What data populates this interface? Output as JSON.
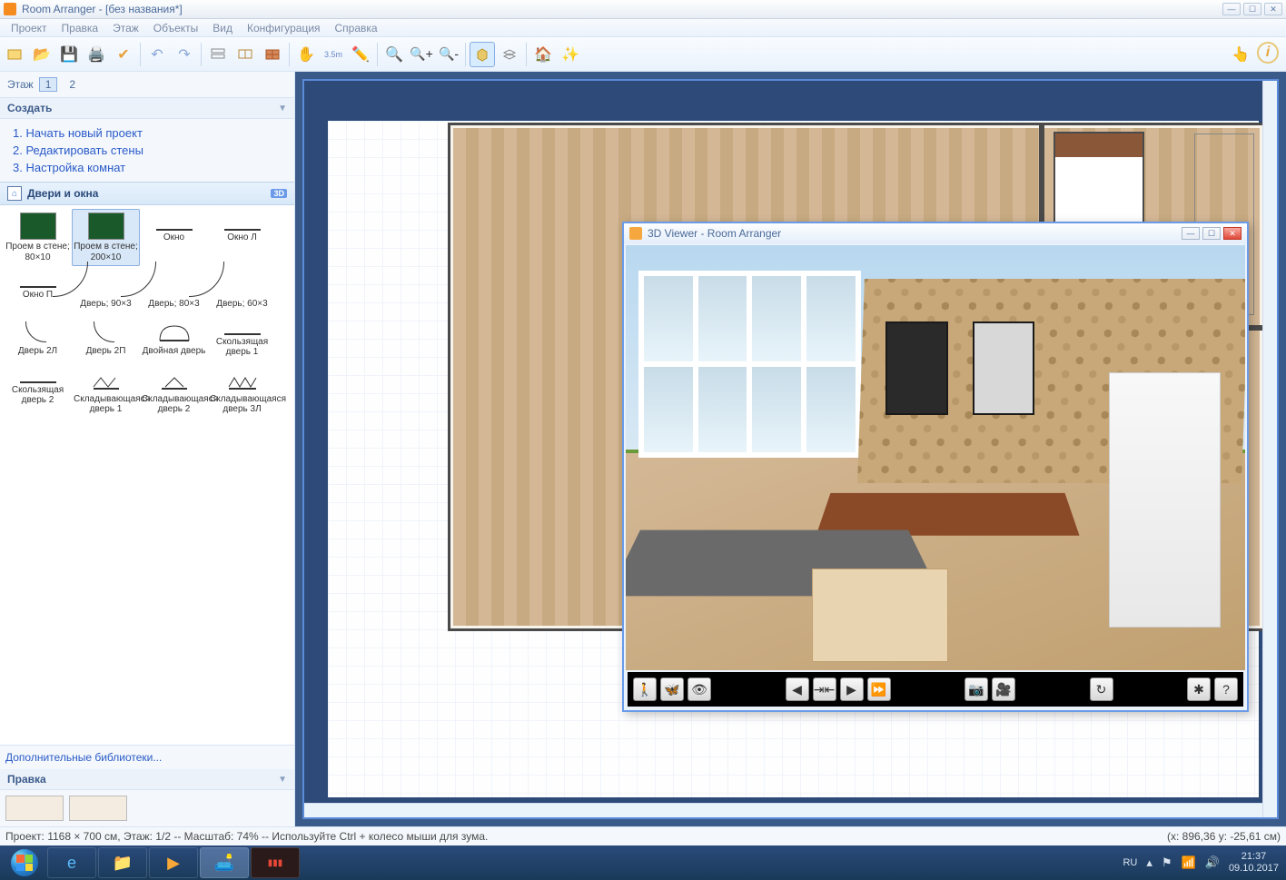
{
  "titlebar": {
    "title": "Room Arranger - [без названия*]"
  },
  "menu": {
    "items": [
      "Проект",
      "Правка",
      "Этаж",
      "Объекты",
      "Вид",
      "Конфигурация",
      "Справка"
    ]
  },
  "toolbar": {
    "measure_label": "3.5m"
  },
  "sidebar": {
    "floor_label": "Этаж",
    "floors": [
      "1",
      "2"
    ],
    "create_header": "Создать",
    "create_steps": [
      "1. Начать новый проект",
      "2. Редактировать стены",
      "3. Настройка комнат"
    ],
    "category": {
      "name": "Двери и окна",
      "badge": "3D"
    },
    "library_items": [
      {
        "label": "Проем в стене; 80×10"
      },
      {
        "label": "Проем в стене; 200×10"
      },
      {
        "label": "Окно"
      },
      {
        "label": "Окно Л"
      },
      {
        "label": "Окно П"
      },
      {
        "label": "Дверь; 90×3"
      },
      {
        "label": "Дверь; 80×3"
      },
      {
        "label": "Дверь; 60×3"
      },
      {
        "label": "Дверь 2Л"
      },
      {
        "label": "Дверь 2П"
      },
      {
        "label": "Двойная дверь"
      },
      {
        "label": "Скользящая дверь 1"
      },
      {
        "label": "Скользящая дверь 2"
      },
      {
        "label": "Складывающаяся дверь 1"
      },
      {
        "label": "Складывающаяся дверь 2"
      },
      {
        "label": "Складывающаяся дверь 3Л"
      }
    ],
    "more_libs": "Дополнительные библиотеки...",
    "edit_header": "Правка"
  },
  "viewer3d": {
    "title": "3D Viewer - Room Arranger"
  },
  "statusbar": {
    "left": "Проект: 1168 × 700 см, Этаж: 1/2 -- Масштаб: 74% -- Используйте Ctrl + колесо мыши для зума.",
    "right": "(x: 896,36 y: -25,61 см)"
  },
  "taskbar": {
    "lang": "RU",
    "time": "21:37",
    "date": "09.10.2017"
  }
}
